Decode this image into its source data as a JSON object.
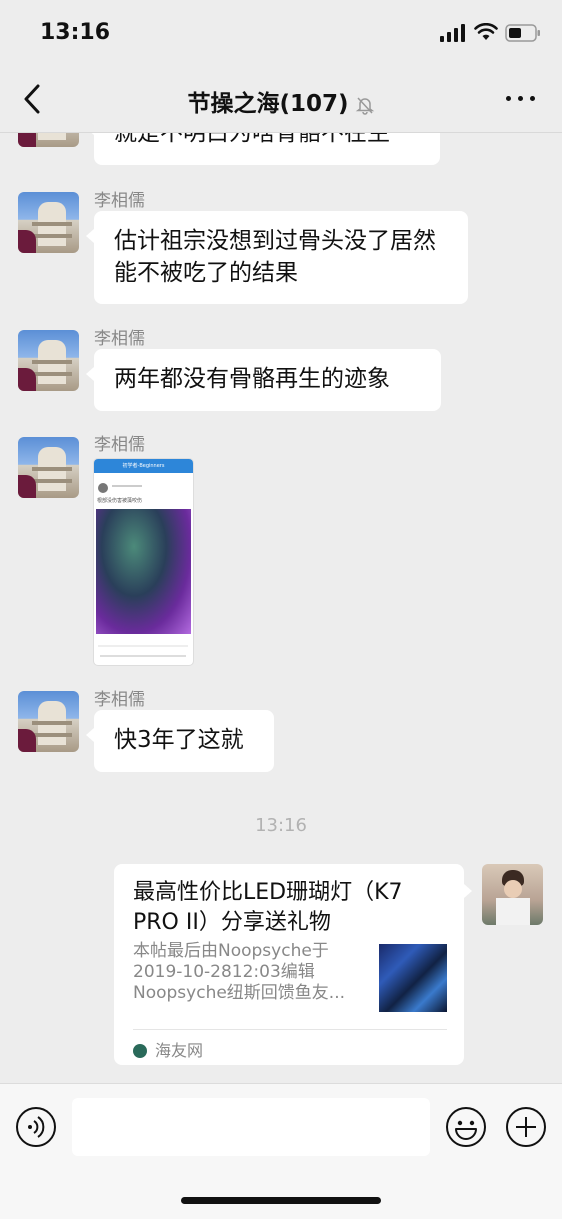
{
  "status_bar": {
    "time": "13:16"
  },
  "nav": {
    "title": "节操之海(107)"
  },
  "messages": [
    {
      "sender": "",
      "text": "就是不明白为啥骨骼不在生"
    },
    {
      "sender": "李相儒",
      "text": "估计祖宗没想到过骨头没了居然能不被吃了的结果"
    },
    {
      "sender": "李相儒",
      "text": "两年都没有骨骼再生的迹象"
    },
    {
      "sender": "李相儒",
      "image": "screenshot",
      "image_header": "初学者-Beginners",
      "image_caption": "根部没伤害被藻咬伤"
    },
    {
      "sender": "李相儒",
      "text": "快3年了这就"
    }
  ],
  "timestamp": "13:16",
  "link_card": {
    "title": "最高性价比LED珊瑚灯（K7 PRO II）分享送礼物",
    "desc": "本帖最后由Noopsyche于 2019-10-2812:03编辑 Noopsyche纽斯回馈鱼友...",
    "source": "海友网"
  },
  "input": {
    "placeholder": ""
  },
  "icons": [
    "back-icon",
    "mute-icon",
    "more-icon",
    "voice-icon",
    "emoji-icon",
    "plus-icon"
  ]
}
